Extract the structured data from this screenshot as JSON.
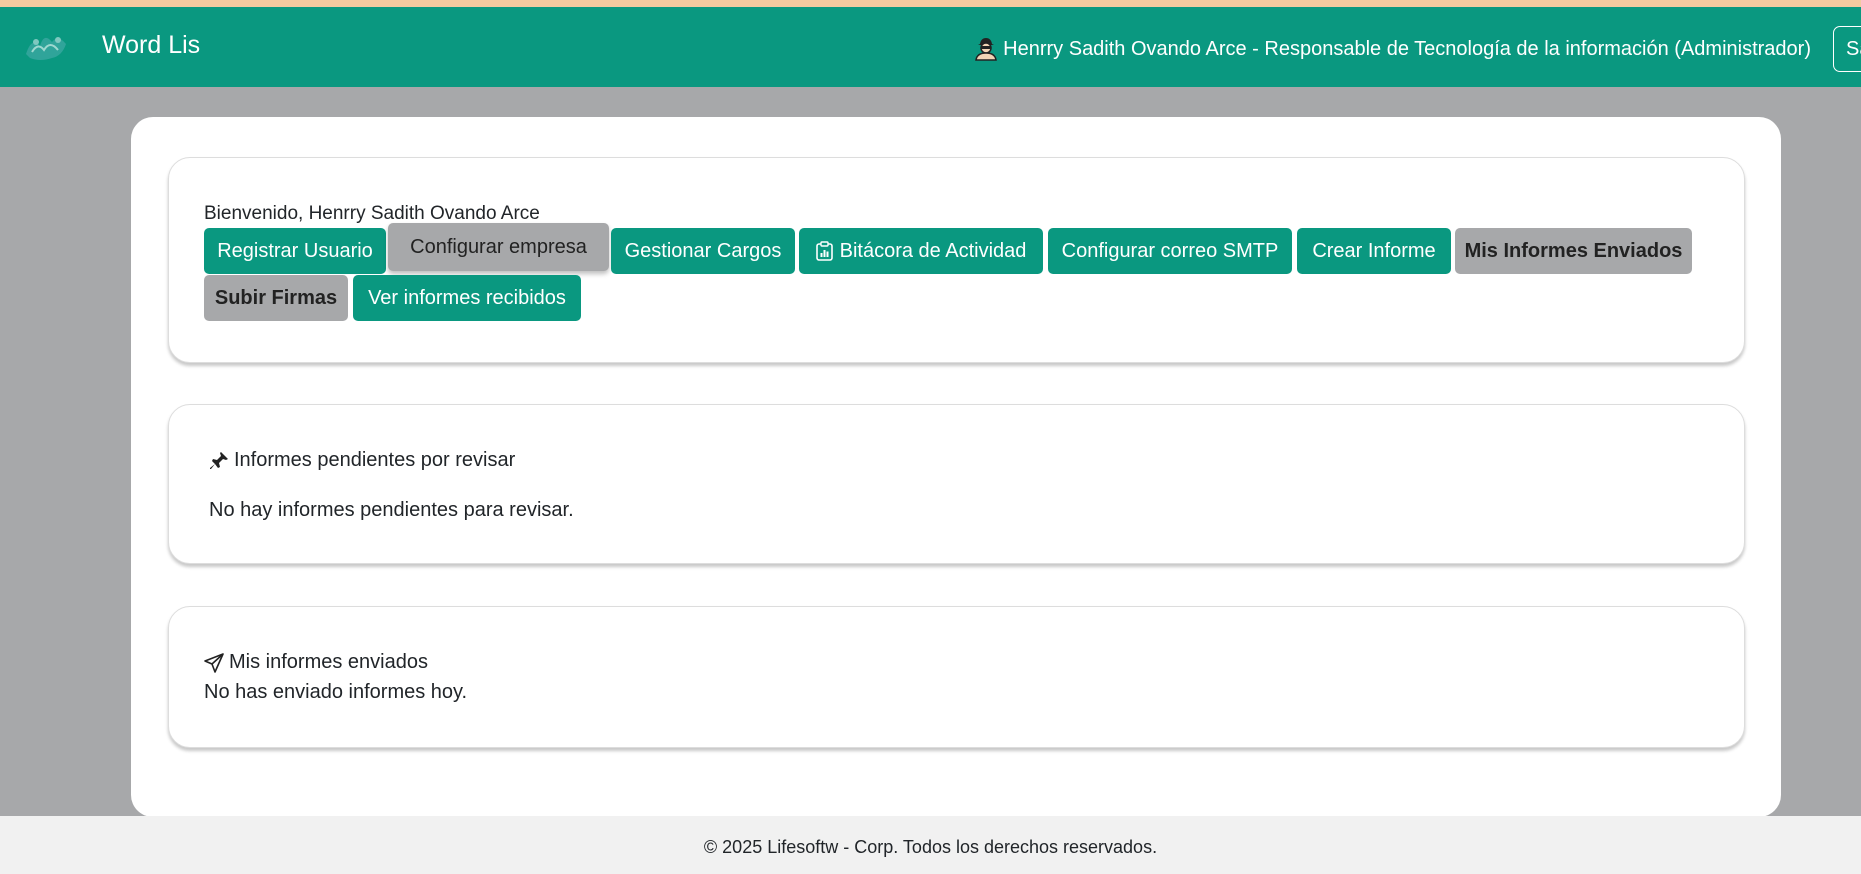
{
  "navbar": {
    "brand": "Word Lis",
    "user_label": "Henrry Sadith Ovando Arce - Responsable de Tecnología de la información (Administrador)",
    "logout_label": "Salir"
  },
  "welcome": "Bienvenido, Henrry Sadith Ovando Arce",
  "buttons": {
    "registrar_usuario": "Registrar Usuario",
    "configurar_empresa": "Configurar empresa",
    "gestionar_cargos": "Gestionar Cargos",
    "bitacora": "Bitácora de Actividad",
    "configurar_smtp": "Configurar correo SMTP",
    "crear_informe": "Crear Informe",
    "mis_informes_enviados": "Mis Informes Enviados",
    "subir_firmas": "Subir Firmas",
    "ver_informes_recibidos": "Ver informes recibidos"
  },
  "pending": {
    "title": "Informes pendientes por revisar",
    "empty": "No hay informes pendientes para revisar."
  },
  "sent": {
    "title": "Mis informes enviados",
    "empty": "No has enviado informes hoy."
  },
  "footer": "© 2025 Lifesoftw - Corp. Todos los derechos reservados.",
  "icons": {
    "logo": "app-logo",
    "user": "user-secret-icon",
    "bitacora": "clipboard-data-icon",
    "pending": "pushpin-icon",
    "sent": "send-icon"
  },
  "colors": {
    "primary": "#0a9880",
    "secondary": "#a7a8aa",
    "top_line": "#f3caa0"
  }
}
